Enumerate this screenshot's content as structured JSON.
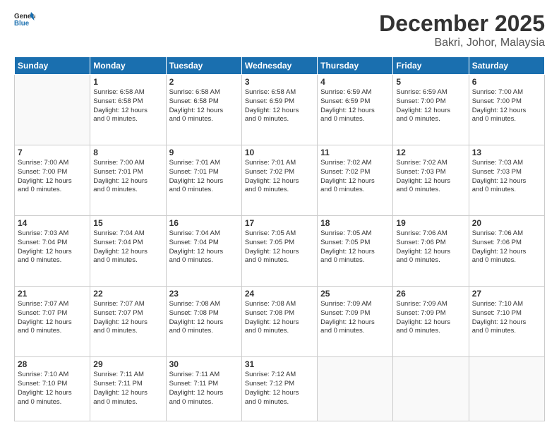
{
  "logo": {
    "general": "General",
    "blue": "Blue"
  },
  "title": "December 2025",
  "location": "Bakri, Johor, Malaysia",
  "weekdays": [
    "Sunday",
    "Monday",
    "Tuesday",
    "Wednesday",
    "Thursday",
    "Friday",
    "Saturday"
  ],
  "weeks": [
    [
      {
        "day": "",
        "info": ""
      },
      {
        "day": "1",
        "info": "Sunrise: 6:58 AM\nSunset: 6:58 PM\nDaylight: 12 hours\nand 0 minutes."
      },
      {
        "day": "2",
        "info": "Sunrise: 6:58 AM\nSunset: 6:58 PM\nDaylight: 12 hours\nand 0 minutes."
      },
      {
        "day": "3",
        "info": "Sunrise: 6:58 AM\nSunset: 6:59 PM\nDaylight: 12 hours\nand 0 minutes."
      },
      {
        "day": "4",
        "info": "Sunrise: 6:59 AM\nSunset: 6:59 PM\nDaylight: 12 hours\nand 0 minutes."
      },
      {
        "day": "5",
        "info": "Sunrise: 6:59 AM\nSunset: 7:00 PM\nDaylight: 12 hours\nand 0 minutes."
      },
      {
        "day": "6",
        "info": "Sunrise: 7:00 AM\nSunset: 7:00 PM\nDaylight: 12 hours\nand 0 minutes."
      }
    ],
    [
      {
        "day": "7",
        "info": "Sunrise: 7:00 AM\nSunset: 7:00 PM\nDaylight: 12 hours\nand 0 minutes."
      },
      {
        "day": "8",
        "info": "Sunrise: 7:00 AM\nSunset: 7:01 PM\nDaylight: 12 hours\nand 0 minutes."
      },
      {
        "day": "9",
        "info": "Sunrise: 7:01 AM\nSunset: 7:01 PM\nDaylight: 12 hours\nand 0 minutes."
      },
      {
        "day": "10",
        "info": "Sunrise: 7:01 AM\nSunset: 7:02 PM\nDaylight: 12 hours\nand 0 minutes."
      },
      {
        "day": "11",
        "info": "Sunrise: 7:02 AM\nSunset: 7:02 PM\nDaylight: 12 hours\nand 0 minutes."
      },
      {
        "day": "12",
        "info": "Sunrise: 7:02 AM\nSunset: 7:03 PM\nDaylight: 12 hours\nand 0 minutes."
      },
      {
        "day": "13",
        "info": "Sunrise: 7:03 AM\nSunset: 7:03 PM\nDaylight: 12 hours\nand 0 minutes."
      }
    ],
    [
      {
        "day": "14",
        "info": "Sunrise: 7:03 AM\nSunset: 7:04 PM\nDaylight: 12 hours\nand 0 minutes."
      },
      {
        "day": "15",
        "info": "Sunrise: 7:04 AM\nSunset: 7:04 PM\nDaylight: 12 hours\nand 0 minutes."
      },
      {
        "day": "16",
        "info": "Sunrise: 7:04 AM\nSunset: 7:04 PM\nDaylight: 12 hours\nand 0 minutes."
      },
      {
        "day": "17",
        "info": "Sunrise: 7:05 AM\nSunset: 7:05 PM\nDaylight: 12 hours\nand 0 minutes."
      },
      {
        "day": "18",
        "info": "Sunrise: 7:05 AM\nSunset: 7:05 PM\nDaylight: 12 hours\nand 0 minutes."
      },
      {
        "day": "19",
        "info": "Sunrise: 7:06 AM\nSunset: 7:06 PM\nDaylight: 12 hours\nand 0 minutes."
      },
      {
        "day": "20",
        "info": "Sunrise: 7:06 AM\nSunset: 7:06 PM\nDaylight: 12 hours\nand 0 minutes."
      }
    ],
    [
      {
        "day": "21",
        "info": "Sunrise: 7:07 AM\nSunset: 7:07 PM\nDaylight: 12 hours\nand 0 minutes."
      },
      {
        "day": "22",
        "info": "Sunrise: 7:07 AM\nSunset: 7:07 PM\nDaylight: 12 hours\nand 0 minutes."
      },
      {
        "day": "23",
        "info": "Sunrise: 7:08 AM\nSunset: 7:08 PM\nDaylight: 12 hours\nand 0 minutes."
      },
      {
        "day": "24",
        "info": "Sunrise: 7:08 AM\nSunset: 7:08 PM\nDaylight: 12 hours\nand 0 minutes."
      },
      {
        "day": "25",
        "info": "Sunrise: 7:09 AM\nSunset: 7:09 PM\nDaylight: 12 hours\nand 0 minutes."
      },
      {
        "day": "26",
        "info": "Sunrise: 7:09 AM\nSunset: 7:09 PM\nDaylight: 12 hours\nand 0 minutes."
      },
      {
        "day": "27",
        "info": "Sunrise: 7:10 AM\nSunset: 7:10 PM\nDaylight: 12 hours\nand 0 minutes."
      }
    ],
    [
      {
        "day": "28",
        "info": "Sunrise: 7:10 AM\nSunset: 7:10 PM\nDaylight: 12 hours\nand 0 minutes."
      },
      {
        "day": "29",
        "info": "Sunrise: 7:11 AM\nSunset: 7:11 PM\nDaylight: 12 hours\nand 0 minutes."
      },
      {
        "day": "30",
        "info": "Sunrise: 7:11 AM\nSunset: 7:11 PM\nDaylight: 12 hours\nand 0 minutes."
      },
      {
        "day": "31",
        "info": "Sunrise: 7:12 AM\nSunset: 7:12 PM\nDaylight: 12 hours\nand 0 minutes."
      },
      {
        "day": "",
        "info": ""
      },
      {
        "day": "",
        "info": ""
      },
      {
        "day": "",
        "info": ""
      }
    ]
  ]
}
